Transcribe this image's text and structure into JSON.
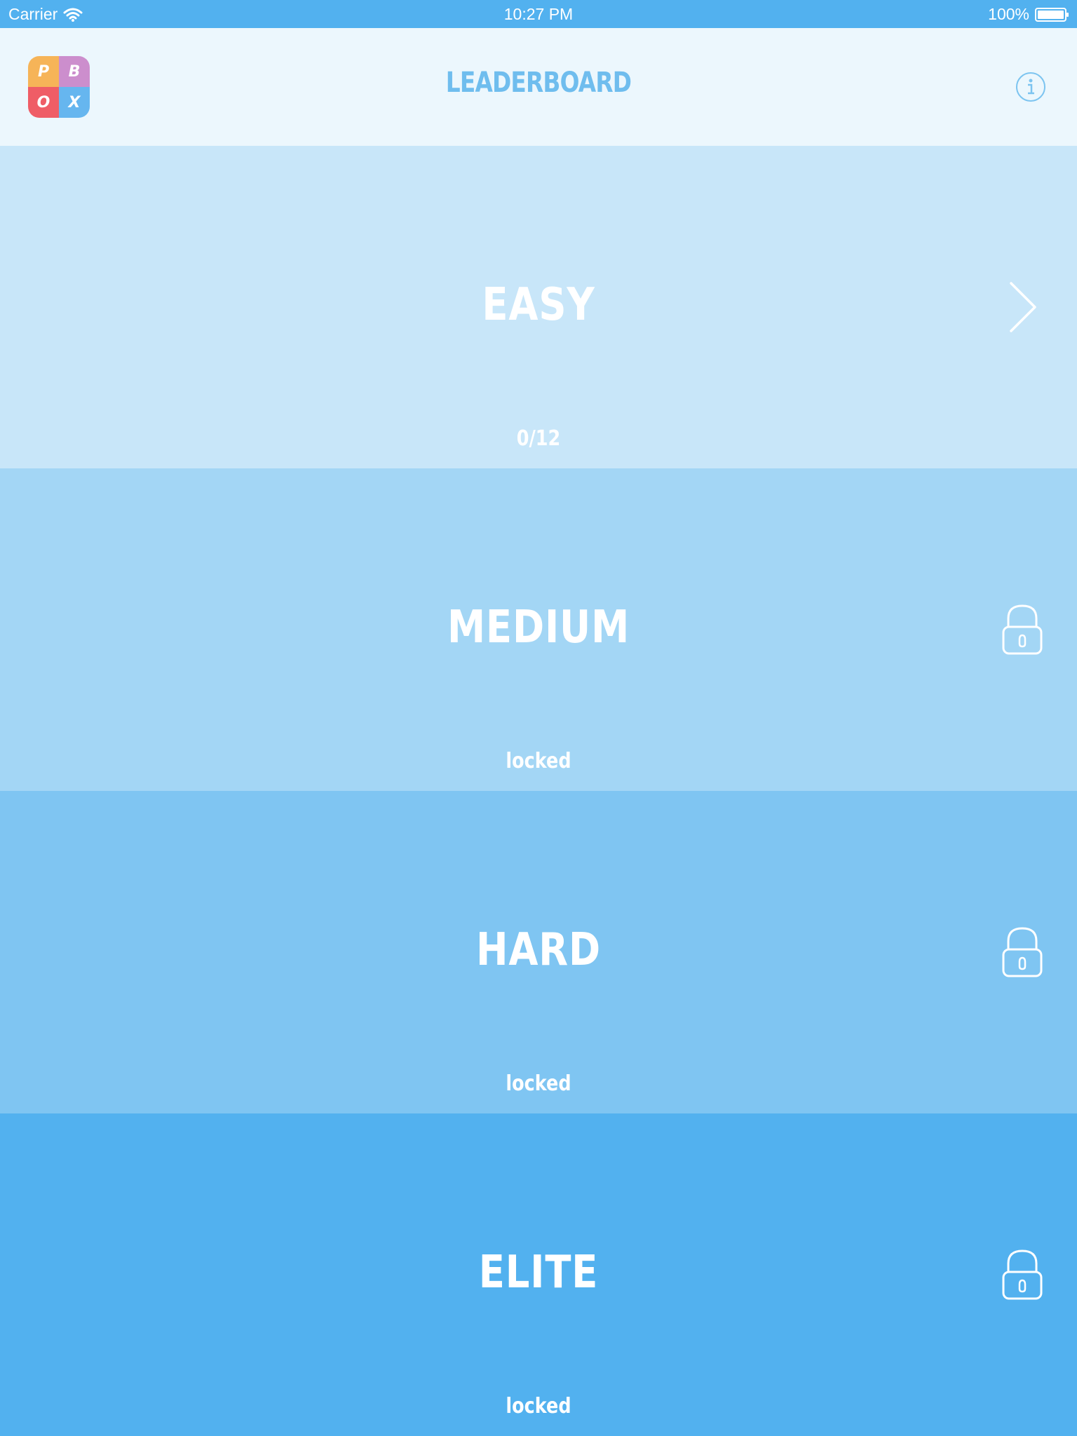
{
  "status_bar": {
    "carrier": "Carrier",
    "time": "10:27 PM",
    "battery": "100%"
  },
  "header": {
    "logo_letters": [
      "P",
      "B",
      "O",
      "X"
    ],
    "title": "LEADERBOARD"
  },
  "levels": [
    {
      "name": "EASY",
      "status": "0/12",
      "icon": "chevron-right-icon",
      "color": "#c8e6f9"
    },
    {
      "name": "MEDIUM",
      "status": "locked",
      "icon": "lock-icon",
      "color": "#a3d6f5"
    },
    {
      "name": "HARD",
      "status": "locked",
      "icon": "lock-icon",
      "color": "#7fc5f2"
    },
    {
      "name": "ELITE",
      "status": "locked",
      "icon": "lock-icon",
      "color": "#52b1ef"
    }
  ],
  "colors": {
    "status_bar": "#52b1ef",
    "header_bg": "#ecf7fd",
    "title": "#6fbdee"
  }
}
